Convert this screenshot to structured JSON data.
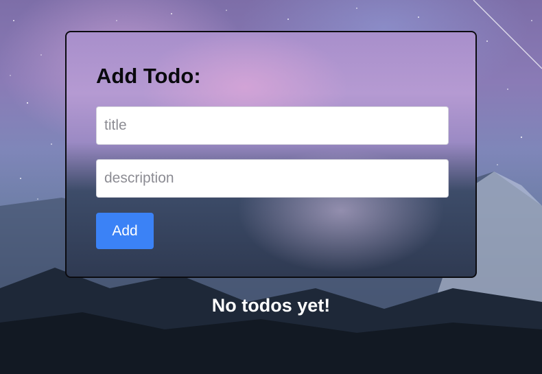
{
  "form": {
    "heading": "Add Todo:",
    "title_placeholder": "title",
    "title_value": "",
    "description_placeholder": "description",
    "description_value": "",
    "add_label": "Add"
  },
  "todos": {
    "empty_message": "No todos yet!"
  },
  "colors": {
    "accent": "#3b82f6",
    "card_border": "#0b0b10",
    "heading_text": "#0a0a0e",
    "empty_text": "#ffffff"
  }
}
